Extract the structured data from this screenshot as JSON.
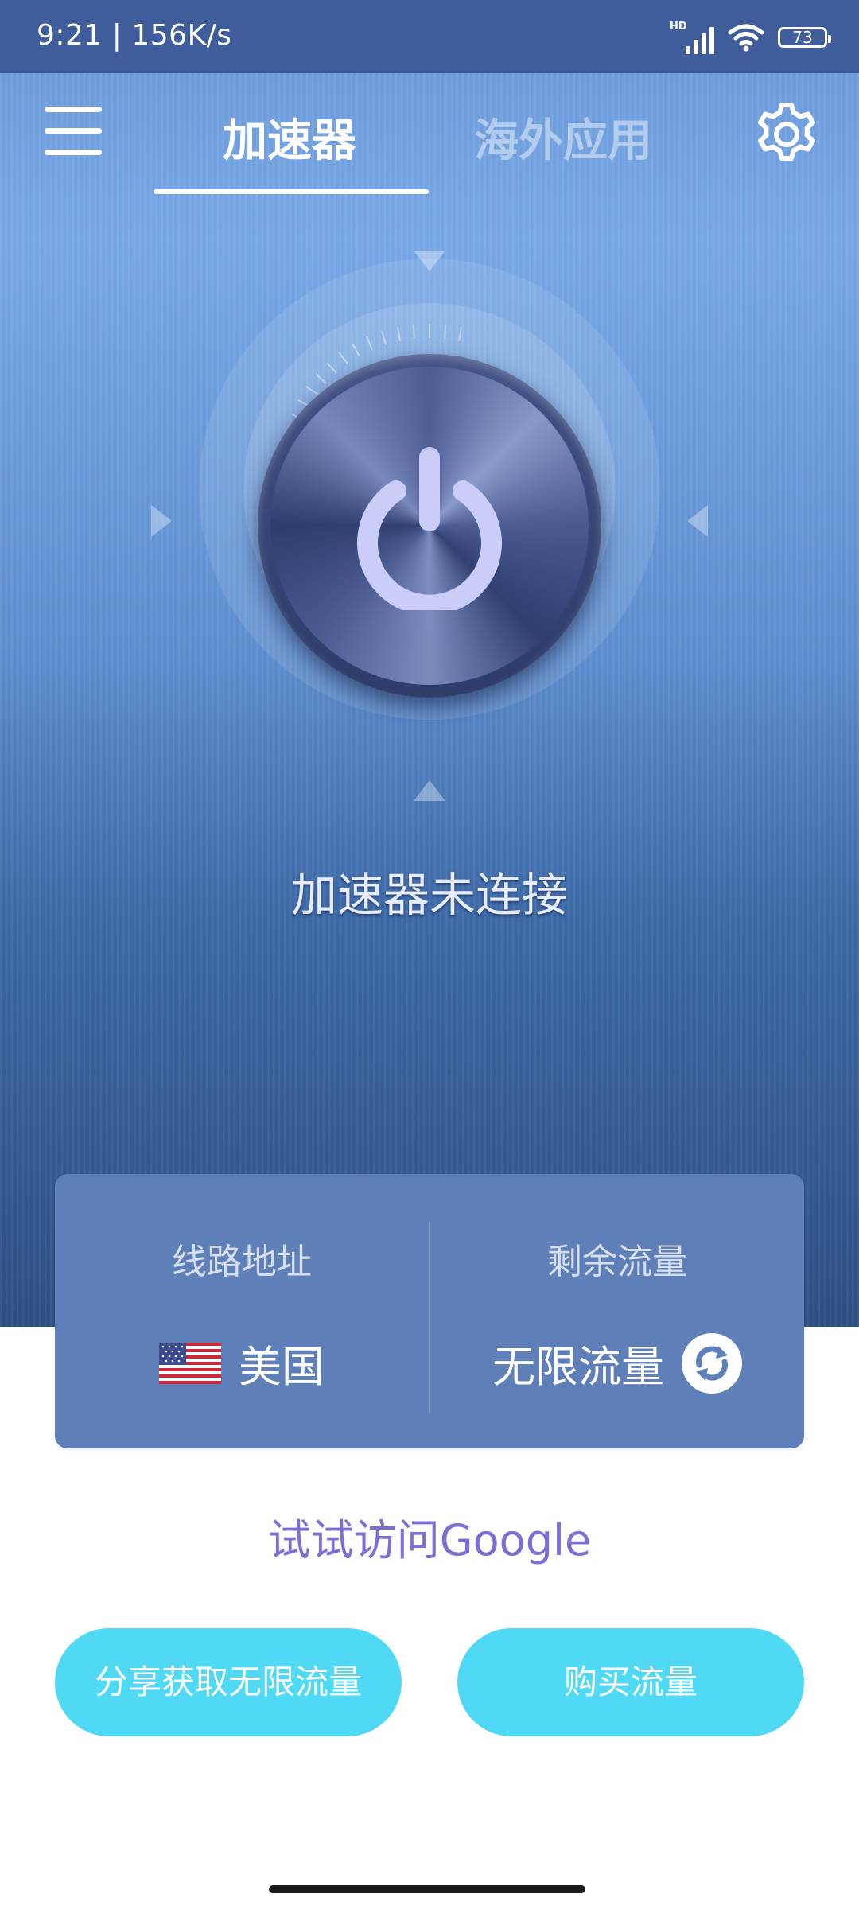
{
  "status_bar": {
    "time": "9:21 | 156K/s",
    "network_badge": "HD",
    "battery": "73",
    "icons": [
      "signal-icon",
      "wifi-icon",
      "battery-icon"
    ]
  },
  "header": {
    "menu_icon": "menu-icon",
    "tabs": [
      {
        "label": "加速器",
        "active": true
      },
      {
        "label": "海外应用",
        "active": false
      }
    ],
    "settings_icon": "gear-icon"
  },
  "main": {
    "power_icon": "power-icon",
    "connection_status": "加速器未连接"
  },
  "info_card": {
    "route": {
      "label": "线路地址",
      "value": "美国",
      "flag_icon": "us-flag-icon"
    },
    "traffic": {
      "label": "剩余流量",
      "value": "无限流量",
      "refresh_icon": "refresh-icon"
    }
  },
  "google_link": "试试访问Google",
  "buttons": {
    "share_label": "分享获取无限流量",
    "buy_label": "购买流量"
  },
  "colors": {
    "status_bar_bg": "#3f5c9b",
    "card_bg": "#5e7fb8",
    "button_bg": "#4fd9f4",
    "link_color": "#7d6ed6"
  }
}
